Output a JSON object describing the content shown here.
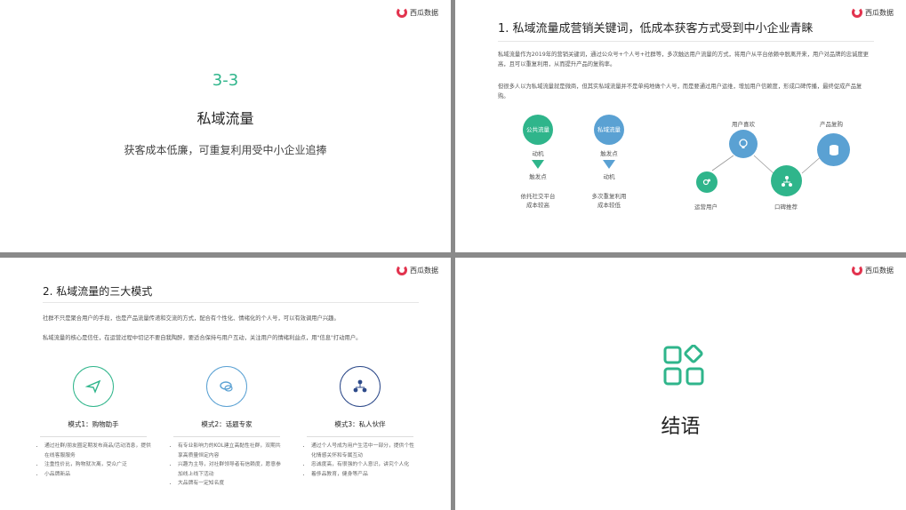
{
  "logo_text": "西瓜数据",
  "slide1": {
    "number": "3-3",
    "title": "私域流量",
    "subtitle": "获客成本低廉，可重复利用受中小企业追捧"
  },
  "slide2": {
    "heading": "1. 私域流量成营销关键词，低成本获客方式受到中小企业青睐",
    "para1": "私域流量作为2019年的营销关键词，通过公众号+个人号+社群等，多次触达用户流量的方式，将用户从平台依赖中脱离开来，用户对品牌的忠诚度更高，且可以重复利用，从而提升产品的复购率。",
    "para2": "但很多人以为私域流量就是微商，但其实私域流量并不是单纯地做个人号，而是要通过用户运维，增加用户信赖度，形成口碑传播，最终促成产品复购。",
    "col1": {
      "circle": "公共流量",
      "top": "动机",
      "bottom": "触发点",
      "note1": "依托社交平台",
      "note2": "成本较高"
    },
    "col2": {
      "circle": "私域流量",
      "top": "触发点",
      "bottom": "动机",
      "note1": "多次重复利用",
      "note2": "成本较低"
    },
    "diagram": {
      "user_like": "用户喜欢",
      "repurchase": "产品复购",
      "ops_user": "运营用户",
      "word_of_mouth": "口碑推荐"
    }
  },
  "slide3": {
    "heading": "2. 私域流量的三大模式",
    "para1": "社群不只是聚合用户的手段，也是产品流量传递和交流的方式，配合有个性化、情绪化的个人号，可以有效调用户兴趣。",
    "para2": "私域流量的核心是信任，在运营过程中切记不要自我陶醉，要适合保持与用户互动，关注用户的情绪利益点，用\"信息\"打动用户。",
    "modes": [
      {
        "title": "模式1：购物助手",
        "bullets": [
          "通过社群/朋友圈定期发布商品/活动消息，提供在线客服服务",
          "注重性价比，购物就次离，受众广泛",
          "小品牌新品"
        ]
      },
      {
        "title": "模式2：话题专家",
        "bullets": [
          "有专业影响力的KOL建立高黏性社群，双期共享高质量恒定内容",
          "兴趣为主导，对社群领导者有信赖度，愿意参加线上线下活动",
          "大品牌有一定知名度"
        ]
      },
      {
        "title": "模式3：私人伙伴",
        "bullets": [
          "通过个人号成为用户生活中一部分，提供个性化情感关怀和专属互动",
          "忠诚度高，有很强的个人意识，讲究个人化",
          "着侈品教育，健身等产品"
        ]
      }
    ]
  },
  "slide4": {
    "title": "结语"
  },
  "colors": {
    "green": "#2fb58b",
    "blue": "#5aa1d3",
    "navy": "#2d4a8a",
    "brand_red": "#e2334e"
  }
}
